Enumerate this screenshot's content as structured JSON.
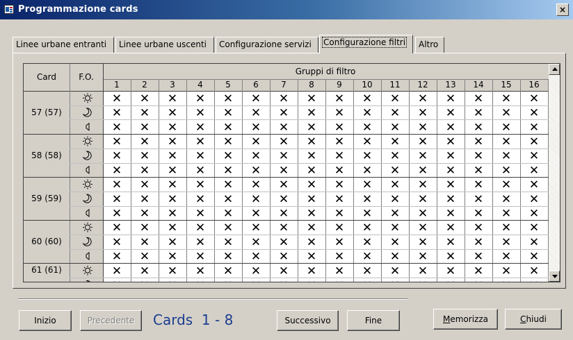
{
  "window": {
    "title": "Programmazione cards",
    "close_label": "×"
  },
  "tabs": [
    {
      "label": "Linee urbane entranti",
      "active": false
    },
    {
      "label": "Linee urbane uscenti",
      "active": false
    },
    {
      "label": "Configurazione servizi",
      "active": false
    },
    {
      "label": "Configurazione filtri",
      "active": true
    },
    {
      "label": "Altro",
      "active": false
    }
  ],
  "grid": {
    "header_card": "Card",
    "header_fo": "F.O.",
    "header_group": "Gruppi di filtro",
    "columns": [
      "1",
      "2",
      "3",
      "4",
      "5",
      "6",
      "7",
      "8",
      "9",
      "10",
      "11",
      "12",
      "13",
      "14",
      "15",
      "16"
    ],
    "cell_mark": "✕",
    "fo_icons": [
      "sun-icon",
      "moon-icon",
      "speaker-icon"
    ],
    "cards": [
      "57 (57)",
      "58 (58)",
      "59 (59)",
      "60 (60)",
      "61 (61)"
    ]
  },
  "footer": {
    "inizio": "Inizio",
    "precedente": "Precedente",
    "cards_label": "Cards  1 - 8",
    "successivo": "Successivo",
    "fine": "Fine",
    "memorizza_u": "M",
    "memorizza_rest": "emorizza",
    "chiudi_u": "C",
    "chiudi_rest": "hiudi"
  }
}
